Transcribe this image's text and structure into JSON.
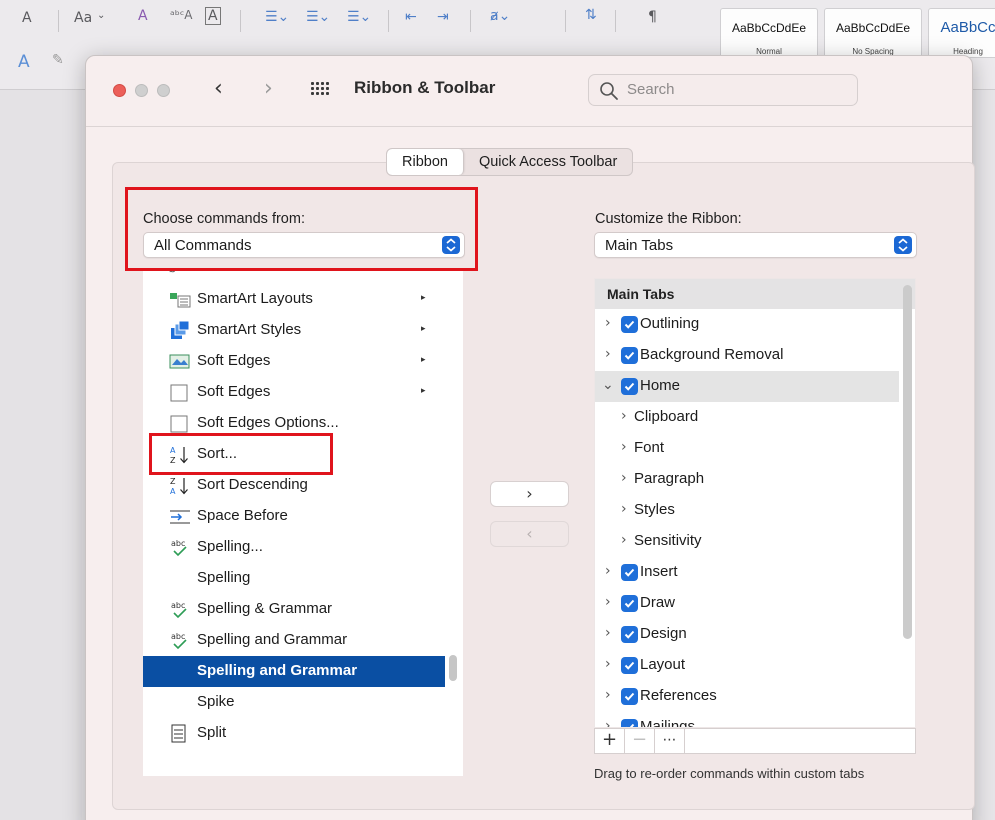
{
  "background_ribbon": {
    "font_glyphs": [
      "A",
      "Aa"
    ],
    "style_gallery": [
      {
        "preview": "AaBbCcDdEe",
        "name": "Normal"
      },
      {
        "preview": "AaBbCcDdEe",
        "name": "No Spacing"
      },
      {
        "preview": "AaBbCc",
        "name": "Heading"
      }
    ]
  },
  "dialog": {
    "title": "Ribbon & Toolbar",
    "search_placeholder": "Search",
    "tabs": [
      {
        "label": "Ribbon",
        "active": true
      },
      {
        "label": "Quick Access Toolbar",
        "active": false
      }
    ],
    "left": {
      "label": "Choose commands from:",
      "selected": "All Commands",
      "items": [
        {
          "label": "SmartArt Layouts",
          "icon": "smartart-layouts-icon",
          "submenu": true
        },
        {
          "label": "SmartArt Styles",
          "icon": "smartart-styles-icon",
          "submenu": true
        },
        {
          "label": "Soft Edges",
          "icon": "soft-edges-icon",
          "submenu": true
        },
        {
          "label": "Soft Edges",
          "icon": "checkbox-empty-icon",
          "submenu": true
        },
        {
          "label": "Soft Edges Options...",
          "icon": "checkbox-empty-icon",
          "submenu": false
        },
        {
          "label": "Sort...",
          "icon": "sort-ascending-icon",
          "submenu": false
        },
        {
          "label": "Sort Descending",
          "icon": "sort-descending-icon",
          "submenu": false
        },
        {
          "label": "Space Before",
          "icon": "space-before-icon",
          "submenu": false
        },
        {
          "label": "Spelling...",
          "icon": "spelling-check-icon",
          "submenu": false
        },
        {
          "label": "Spelling",
          "icon": "",
          "submenu": false
        },
        {
          "label": "Spelling & Grammar",
          "icon": "spelling-check-icon",
          "submenu": false
        },
        {
          "label": "Spelling and Grammar",
          "icon": "spelling-check-icon",
          "submenu": false
        },
        {
          "label": "Spelling and Grammar",
          "icon": "",
          "submenu": false,
          "selected": true
        },
        {
          "label": "Spike",
          "icon": "",
          "submenu": false
        },
        {
          "label": "Split",
          "icon": "split-icon",
          "submenu": false
        }
      ]
    },
    "add_button": "›",
    "remove_button": "‹",
    "right": {
      "label": "Customize the Ribbon:",
      "selected": "Main Tabs",
      "tree_header": "Main Tabs",
      "items": [
        {
          "label": "Outlining",
          "level": 0,
          "checked": true,
          "expanded": false
        },
        {
          "label": "Background Removal",
          "level": 0,
          "checked": true,
          "expanded": false
        },
        {
          "label": "Home",
          "level": 0,
          "checked": true,
          "expanded": true
        },
        {
          "label": "Clipboard",
          "level": 1
        },
        {
          "label": "Font",
          "level": 1
        },
        {
          "label": "Paragraph",
          "level": 1
        },
        {
          "label": "Styles",
          "level": 1
        },
        {
          "label": "Sensitivity",
          "level": 1
        },
        {
          "label": "Insert",
          "level": 0,
          "checked": true,
          "expanded": false
        },
        {
          "label": "Draw",
          "level": 0,
          "checked": true,
          "expanded": false
        },
        {
          "label": "Design",
          "level": 0,
          "checked": true,
          "expanded": false
        },
        {
          "label": "Layout",
          "level": 0,
          "checked": true,
          "expanded": false
        },
        {
          "label": "References",
          "level": 0,
          "checked": true,
          "expanded": false
        },
        {
          "label": "Mailings",
          "level": 0,
          "checked": true,
          "expanded": false
        }
      ],
      "toolbar": {
        "add": "+",
        "remove": "−",
        "more": "⋯"
      },
      "hint": "Drag to re-order commands within custom tabs"
    }
  },
  "colors": {
    "highlight_box": "#e0141c",
    "selection": "#0a4fa3",
    "accent": "#1f6fd9"
  }
}
